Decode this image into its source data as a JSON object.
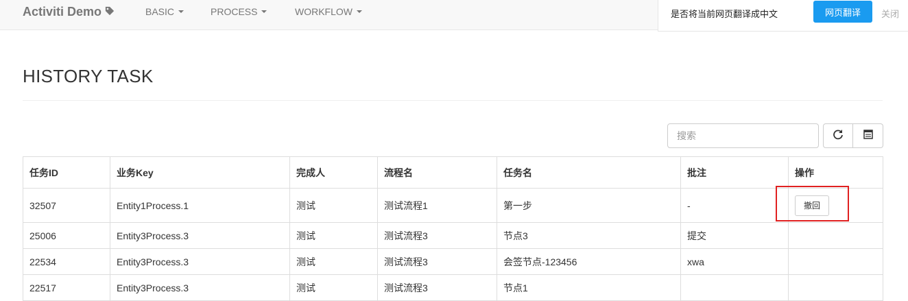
{
  "navbar": {
    "brand": "Activiti Demo",
    "items": [
      {
        "label": "BASIC"
      },
      {
        "label": "PROCESS"
      },
      {
        "label": "WORKFLOW"
      }
    ]
  },
  "translate_bar": {
    "prompt": "是否将当前网页翻译成中文",
    "translate_label": "网页翻译",
    "close_label": "关闭",
    "button_color": "#1a9bf0"
  },
  "page": {
    "title": "HISTORY TASK"
  },
  "toolbar": {
    "search_placeholder": "搜索",
    "refresh_icon": "refresh-icon",
    "columns_icon": "columns-icon"
  },
  "table": {
    "headers": [
      "任务ID",
      "业务Key",
      "完成人",
      "流程名",
      "任务名",
      "批注",
      "操作"
    ],
    "rows": [
      [
        "32507",
        "Entity1Process.1",
        "测试",
        "测试流程1",
        "第一步",
        "-",
        ""
      ],
      [
        "25006",
        "Entity3Process.3",
        "测试",
        "测试流程3",
        "节点3",
        "提交",
        ""
      ],
      [
        "22534",
        "Entity3Process.3",
        "测试",
        "测试流程3",
        "会签节点-123456",
        "xwa",
        ""
      ],
      [
        "22517",
        "Entity3Process.3",
        "测试",
        "测试流程3",
        "节点1",
        "",
        ""
      ]
    ],
    "action_label": "撤回",
    "highlight_color": "#e02020"
  }
}
